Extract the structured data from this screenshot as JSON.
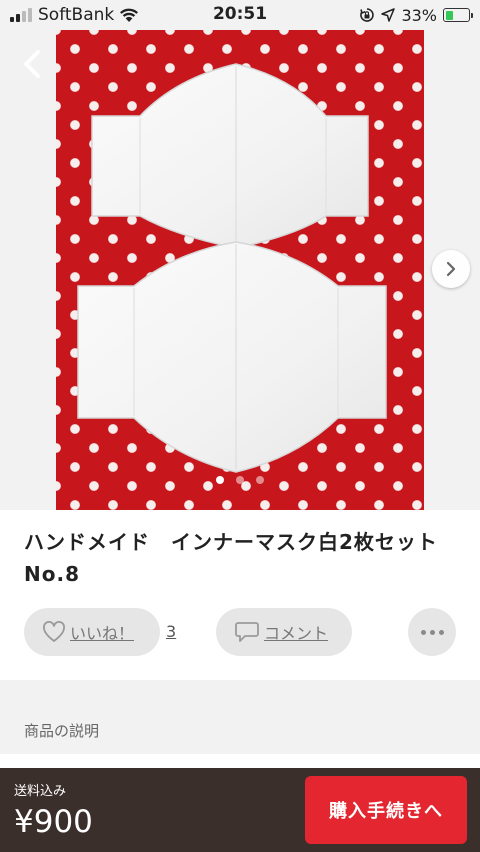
{
  "status_bar": {
    "carrier": "SoftBank",
    "time": "20:51",
    "battery_percent": "33%",
    "battery_level": 0.33,
    "icons": [
      "signal-icon",
      "wifi-icon",
      "rotation-lock-icon",
      "location-icon",
      "battery-charging-icon"
    ]
  },
  "gallery": {
    "page_count": 3,
    "current_page": 1,
    "image_subject": "two white cloth masks on red polka-dot fabric"
  },
  "product": {
    "title": "ハンドメイド　インナーマスク白2枚セット　No.8"
  },
  "actions": {
    "like_label": "いいね！",
    "like_count": "3",
    "comment_label": "コメント"
  },
  "description": {
    "section_label": "商品の説明"
  },
  "purchase": {
    "shipping_label": "送料込み",
    "price": "¥900",
    "buy_button": "購入手続きへ"
  },
  "colors": {
    "accent": "#e3262f",
    "bottom_bar": "#3b2f2c",
    "fabric_red": "#c8161d"
  }
}
